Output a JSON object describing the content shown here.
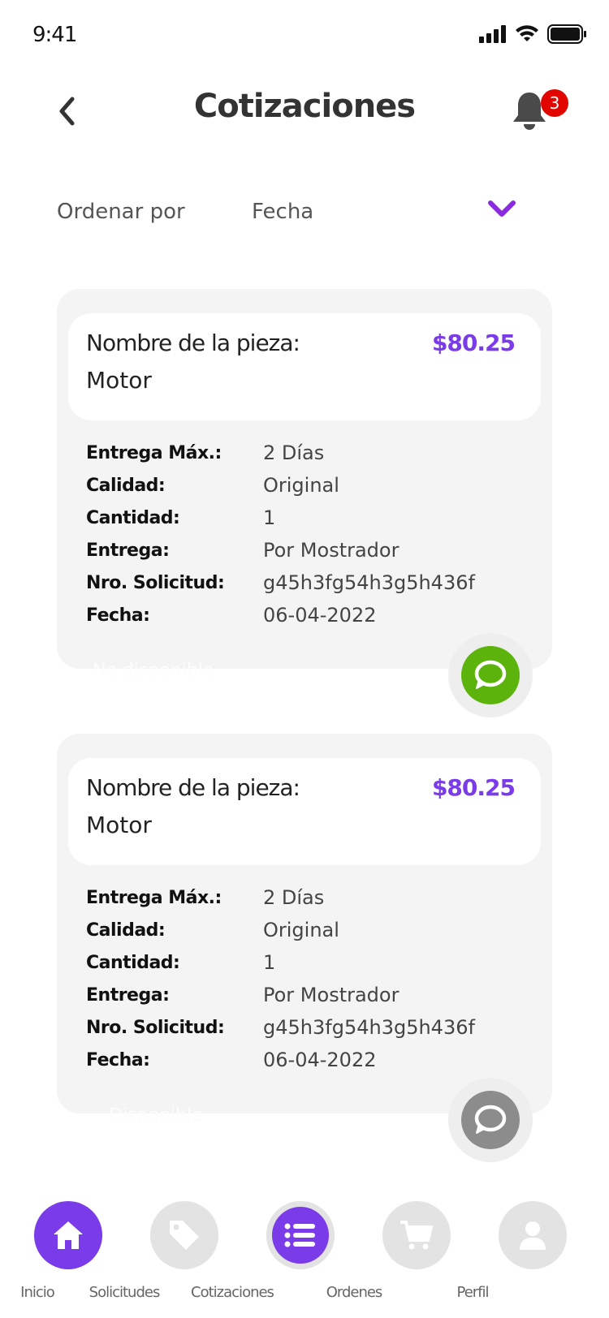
{
  "status": {
    "time": "9:41"
  },
  "header": {
    "title": "Cotizaciones",
    "notification_count": "3"
  },
  "sort": {
    "label": "Ordenar por",
    "value": "Fecha"
  },
  "quotes": [
    {
      "part_label": "Nombre de la pieza:",
      "part_name": "Motor",
      "price": "$80.25",
      "rows": [
        {
          "key": "Entrega Máx.:",
          "value": "2 Días"
        },
        {
          "key": "Calidad:",
          "value": "Original"
        },
        {
          "key": "Cantidad:",
          "value": "1"
        },
        {
          "key": "Entrega:",
          "value": "Por Mostrador"
        },
        {
          "key": "Nro. Solicitud:",
          "value": "g45h3fg54h3g5h436f"
        },
        {
          "key": "Fecha:",
          "value": "06-04-2022"
        }
      ],
      "availability": "No disponible",
      "chat_color": "#5cb30b"
    },
    {
      "part_label": "Nombre de la pieza:",
      "part_name": "Motor",
      "price": "$80.25",
      "rows": [
        {
          "key": "Entrega Máx.:",
          "value": "2 Días"
        },
        {
          "key": "Calidad:",
          "value": "Original"
        },
        {
          "key": "Cantidad:",
          "value": "1"
        },
        {
          "key": "Entrega:",
          "value": "Por Mostrador"
        },
        {
          "key": "Nro. Solicitud:",
          "value": "g45h3fg54h3g5h436f"
        },
        {
          "key": "Fecha:",
          "value": "06-04-2022"
        }
      ],
      "availability": "Disponible",
      "chat_color": "#8c8c8c"
    }
  ],
  "nav": [
    {
      "label": "Inicio",
      "icon": "home-icon"
    },
    {
      "label": "Solicitudes",
      "icon": "tag-icon"
    },
    {
      "label": "Cotizaciones",
      "icon": "list-icon"
    },
    {
      "label": "Ordenes",
      "icon": "cart-icon"
    },
    {
      "label": "Perfil",
      "icon": "user-icon"
    }
  ],
  "colors": {
    "accent": "#7a3ce8",
    "badge": "#e10600"
  }
}
